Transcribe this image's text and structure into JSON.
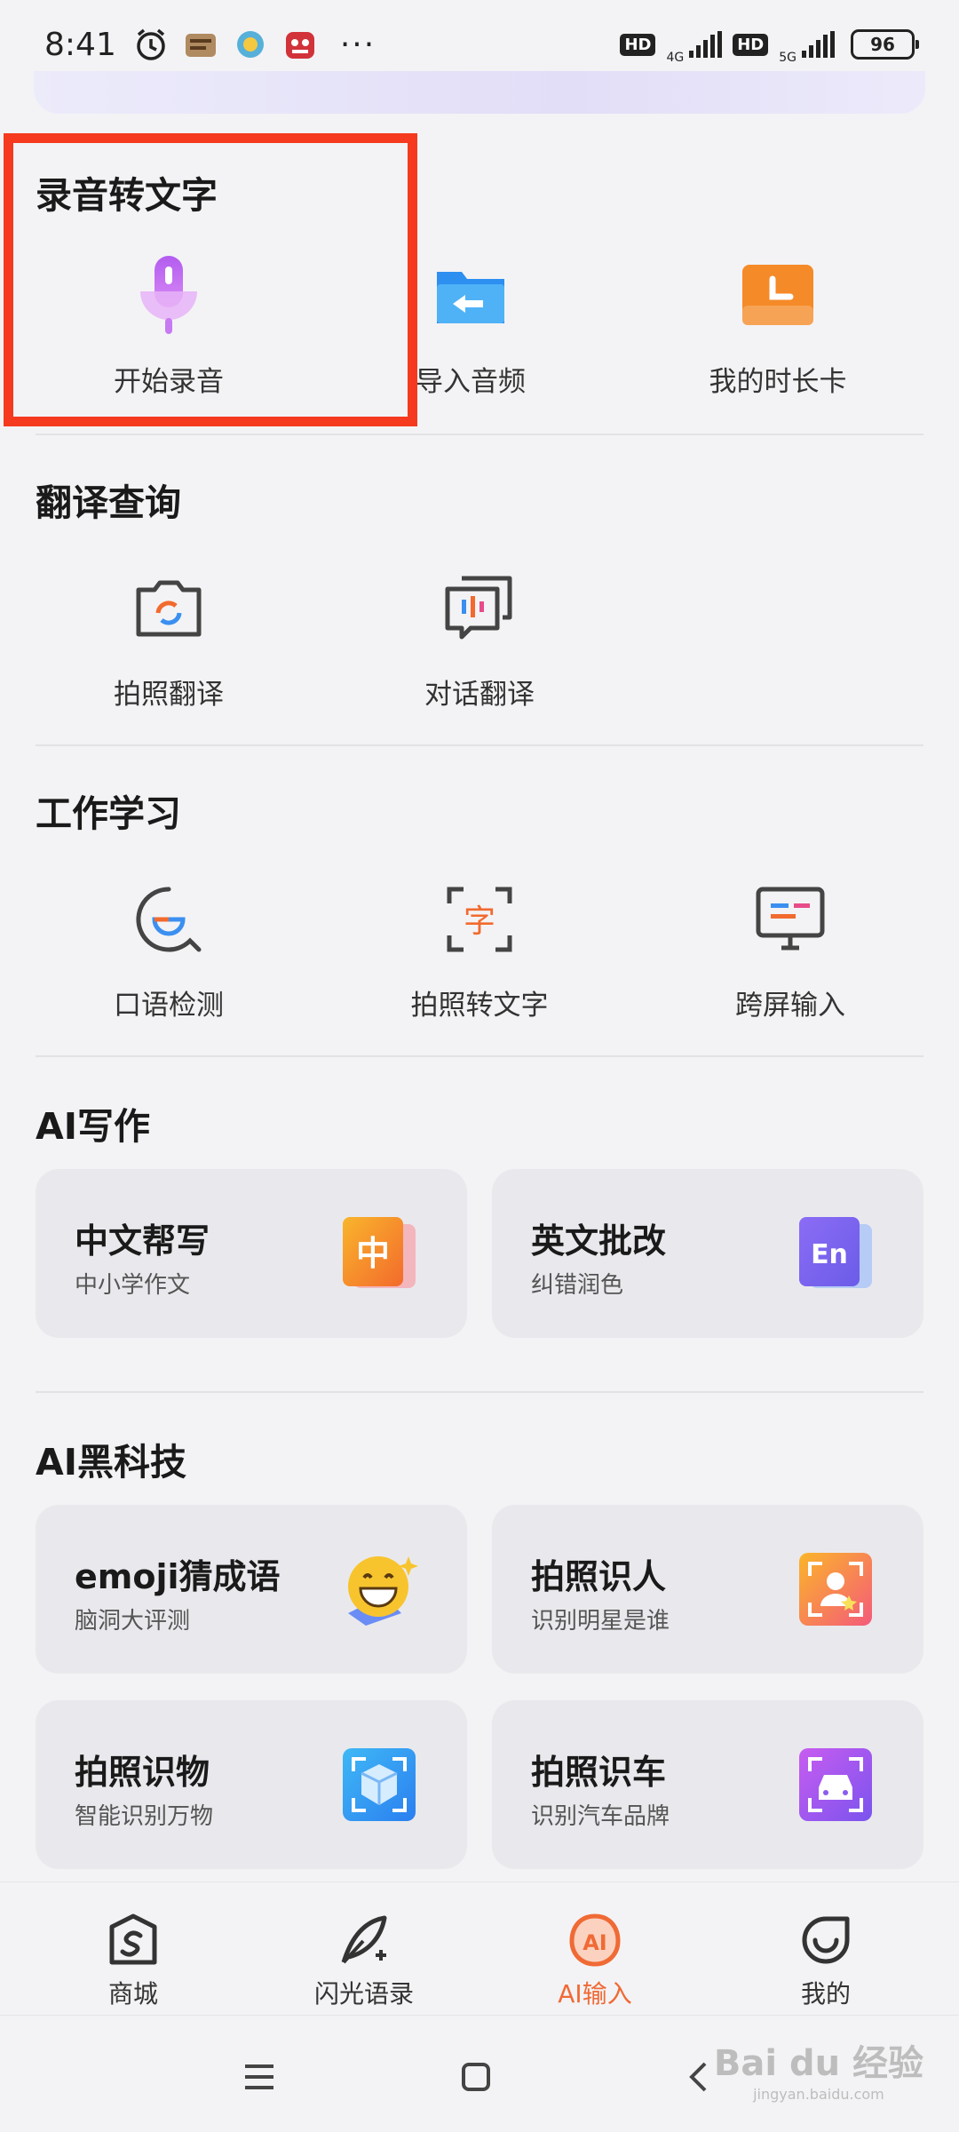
{
  "status": {
    "time": "8:41",
    "dots": "···",
    "hd1": "HD",
    "net1": "4G",
    "hd2": "HD",
    "net2": "5G",
    "battery": "96"
  },
  "sections": {
    "record": {
      "title": "录音转文字",
      "items": [
        "开始录音",
        "导入音频",
        "我的时长卡"
      ]
    },
    "translate": {
      "title": "翻译查询",
      "items": [
        "拍照翻译",
        "对话翻译"
      ]
    },
    "work": {
      "title": "工作学习",
      "items": [
        "口语检测",
        "拍照转文字",
        "跨屏输入"
      ]
    },
    "writing": {
      "title": "AI写作",
      "cards": [
        {
          "title": "中文帮写",
          "subtitle": "中小学作文",
          "icon_text": "中"
        },
        {
          "title": "英文批改",
          "subtitle": "纠错润色",
          "icon_text": "En"
        }
      ]
    },
    "tech": {
      "title": "AI黑科技",
      "cards": [
        {
          "title": "emoji猜成语",
          "subtitle": "脑洞大评测"
        },
        {
          "title": "拍照识人",
          "subtitle": "识别明星是谁"
        },
        {
          "title": "拍照识物",
          "subtitle": "智能识别万物"
        },
        {
          "title": "拍照识车",
          "subtitle": "识别汽车品牌"
        }
      ]
    }
  },
  "bottom_nav": {
    "items": [
      "商城",
      "闪光语录",
      "AI输入",
      "我的"
    ],
    "active": "AI输入",
    "ai_icon_text": "AI"
  },
  "watermark": {
    "line1": "Bai du 经验",
    "line2": "jingyan.baidu.com"
  },
  "colors": {
    "accent": "#f06a35",
    "highlight": "#f53a1f"
  }
}
